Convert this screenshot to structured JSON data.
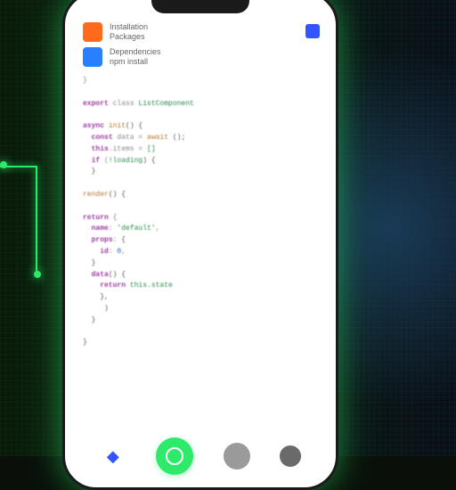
{
  "header": {
    "item1": {
      "title": "Installation",
      "subtitle": "Packages"
    },
    "item2": {
      "title": "Dependencies",
      "subtitle": "npm install"
    }
  },
  "code": {
    "lines": [
      {
        "i": 0,
        "t": "}"
      },
      {
        "i": 0,
        "t": ""
      },
      {
        "i": 0,
        "k": "export",
        "t": " class ",
        "s": "ListComponent"
      },
      {
        "i": 0,
        "t": ""
      },
      {
        "i": 0,
        "k": "async",
        "t": " ",
        "f": "init",
        "o": "() {"
      },
      {
        "i": 1,
        "k": "const",
        "t": " data = ",
        "f": "await",
        "o": " ();"
      },
      {
        "i": 1,
        "k": "this",
        "t": ".items = ",
        "s": "[]",
        ";": ","
      },
      {
        "i": 1,
        "k": "if",
        "t": " (",
        "s": "!loading",
        "o": ") {"
      },
      {
        "i": 1,
        "o": "}"
      },
      {
        "i": 0,
        "t": ""
      },
      {
        "i": 0,
        "f": "render",
        "o": "() {",
        "t": ""
      },
      {
        "i": 0,
        "t": ""
      },
      {
        "i": 0,
        "k": "return",
        "t": " {"
      },
      {
        "i": 1,
        "k": "name",
        "t": ": ",
        "s": "'default'",
        ",": ","
      },
      {
        "i": 1,
        "k": "props",
        "t": ": ",
        "o": "{"
      },
      {
        "i": 2,
        "k": "id",
        "t": ": ",
        "n": "0",
        ",": ","
      },
      {
        "i": 1,
        "o": "}"
      },
      {
        "i": 1,
        "k": "data",
        "o": "() {"
      },
      {
        "i": 2,
        "k": "return",
        "t": " ",
        "s": "this.state"
      },
      {
        "i": 2,
        "o": "},"
      },
      {
        "i": 2,
        "t": " ",
        "o": ")"
      },
      {
        "i": 1,
        "o": "}"
      },
      {
        "i": 0,
        "t": ""
      },
      {
        "i": 0,
        "o": "}"
      }
    ]
  },
  "nav": {
    "home": "◆"
  }
}
